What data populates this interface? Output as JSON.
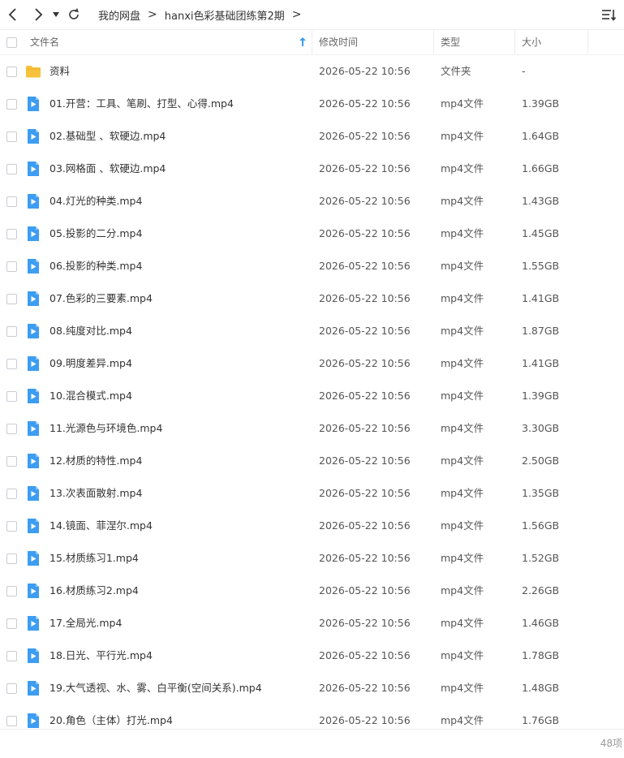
{
  "toolbar": {
    "icons": [
      "back-arrow-icon",
      "forward-arrow-icon",
      "dropdown-caret-icon",
      "refresh-icon",
      "sort-list-icon"
    ],
    "breadcrumbs": [
      "我的网盘",
      "hanxi色彩基础团练第2期"
    ],
    "breadcrumb_separator": ">"
  },
  "header": {
    "name": "文件名",
    "modified": "修改时间",
    "type": "类型",
    "size": "大小",
    "sort_icon": "sort-ascending-arrow-icon"
  },
  "colors": {
    "folder": "#f7c23b",
    "video": "#3c9df2",
    "sort_accent": "#3c9df2"
  },
  "files": [
    {
      "name": "资料",
      "date": "2026-05-22 10:56",
      "type": "文件夹",
      "size": "-",
      "kind": "folder"
    },
    {
      "name": "01.开营：工具、笔刷、打型、心得.mp4",
      "date": "2026-05-22 10:56",
      "type": "mp4文件",
      "size": "1.39GB",
      "kind": "video"
    },
    {
      "name": "02.基础型 、软硬边.mp4",
      "date": "2026-05-22 10:56",
      "type": "mp4文件",
      "size": "1.64GB",
      "kind": "video"
    },
    {
      "name": "03.网格面 、软硬边.mp4",
      "date": "2026-05-22 10:56",
      "type": "mp4文件",
      "size": "1.66GB",
      "kind": "video"
    },
    {
      "name": "04.灯光的种类.mp4",
      "date": "2026-05-22 10:56",
      "type": "mp4文件",
      "size": "1.43GB",
      "kind": "video"
    },
    {
      "name": "05.投影的二分.mp4",
      "date": "2026-05-22 10:56",
      "type": "mp4文件",
      "size": "1.45GB",
      "kind": "video"
    },
    {
      "name": "06.投影的种类.mp4",
      "date": "2026-05-22 10:56",
      "type": "mp4文件",
      "size": "1.55GB",
      "kind": "video"
    },
    {
      "name": "07.色彩的三要素.mp4",
      "date": "2026-05-22 10:56",
      "type": "mp4文件",
      "size": "1.41GB",
      "kind": "video"
    },
    {
      "name": "08.纯度对比.mp4",
      "date": "2026-05-22 10:56",
      "type": "mp4文件",
      "size": "1.87GB",
      "kind": "video"
    },
    {
      "name": "09.明度差异.mp4",
      "date": "2026-05-22 10:56",
      "type": "mp4文件",
      "size": "1.41GB",
      "kind": "video"
    },
    {
      "name": "10.混合模式.mp4",
      "date": "2026-05-22 10:56",
      "type": "mp4文件",
      "size": "1.39GB",
      "kind": "video"
    },
    {
      "name": "11.光源色与环境色.mp4",
      "date": "2026-05-22 10:56",
      "type": "mp4文件",
      "size": "3.30GB",
      "kind": "video"
    },
    {
      "name": "12.材质的特性.mp4",
      "date": "2026-05-22 10:56",
      "type": "mp4文件",
      "size": "2.50GB",
      "kind": "video"
    },
    {
      "name": "13.次表面散射.mp4",
      "date": "2026-05-22 10:56",
      "type": "mp4文件",
      "size": "1.35GB",
      "kind": "video"
    },
    {
      "name": "14.镜面、菲涅尔.mp4",
      "date": "2026-05-22 10:56",
      "type": "mp4文件",
      "size": "1.56GB",
      "kind": "video"
    },
    {
      "name": "15.材质练习1.mp4",
      "date": "2026-05-22 10:56",
      "type": "mp4文件",
      "size": "1.52GB",
      "kind": "video"
    },
    {
      "name": "16.材质练习2.mp4",
      "date": "2026-05-22 10:56",
      "type": "mp4文件",
      "size": "2.26GB",
      "kind": "video"
    },
    {
      "name": "17.全局光.mp4",
      "date": "2026-05-22 10:56",
      "type": "mp4文件",
      "size": "1.46GB",
      "kind": "video"
    },
    {
      "name": "18.日光、平行光.mp4",
      "date": "2026-05-22 10:56",
      "type": "mp4文件",
      "size": "1.78GB",
      "kind": "video"
    },
    {
      "name": "19.大气透视、水、雾、白平衡(空间关系).mp4",
      "date": "2026-05-22 10:56",
      "type": "mp4文件",
      "size": "1.48GB",
      "kind": "video"
    },
    {
      "name": "20.角色（主体）打光.mp4",
      "date": "2026-05-22 10:56",
      "type": "mp4文件",
      "size": "1.76GB",
      "kind": "video"
    }
  ],
  "footer": {
    "item_count": "48项"
  }
}
